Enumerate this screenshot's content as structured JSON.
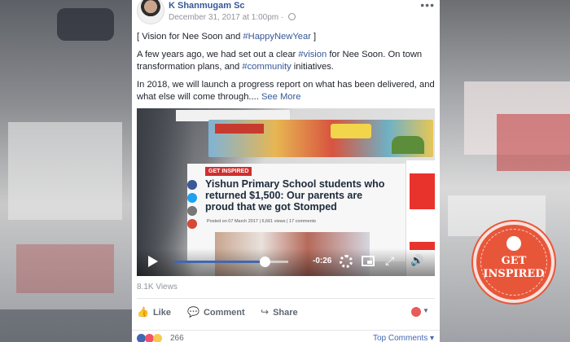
{
  "post": {
    "author": "K Shanmugam Sc",
    "date": "December 31, 2017 at 1:00pm",
    "dot": "·",
    "more_icon": "more-horizontal-icon",
    "line1_prefix": "[ Vision for Nee Soon and ",
    "line1_hashtag": "#HappyNewYear",
    "line1_suffix": " ]",
    "para2_a": "A few years ago, we had set out a clear ",
    "para2_hashtag1": "#vision",
    "para2_b": " for Nee Soon. On town transformation plans, and ",
    "para2_hashtag2": "#community",
    "para2_c": " initiatives.",
    "para3": "In 2018, we will launch a progress report on what has been delivered, and what else will come through....",
    "see_more": "See More"
  },
  "video": {
    "tag": "GET INSPIRED",
    "headline": "Yishun Primary School students who returned $1,500: Our parents are proud that we got Stomped",
    "byline": "Posted on 07 March 2017 | 6,661 views | 17 comments",
    "time_remaining": "-0:26",
    "progress_fraction": 0.79,
    "views": "8.1K Views"
  },
  "actions": {
    "like": "Like",
    "comment": "Comment",
    "share": "Share"
  },
  "reactions": {
    "count": "266",
    "top_comments": "Top Comments ▾"
  },
  "badge": {
    "line1": "GET",
    "line2": "INSPIRED"
  },
  "colors": {
    "facebook_link": "#365899",
    "facebook_blue": "#4267b2",
    "badge": "#e8563a"
  }
}
